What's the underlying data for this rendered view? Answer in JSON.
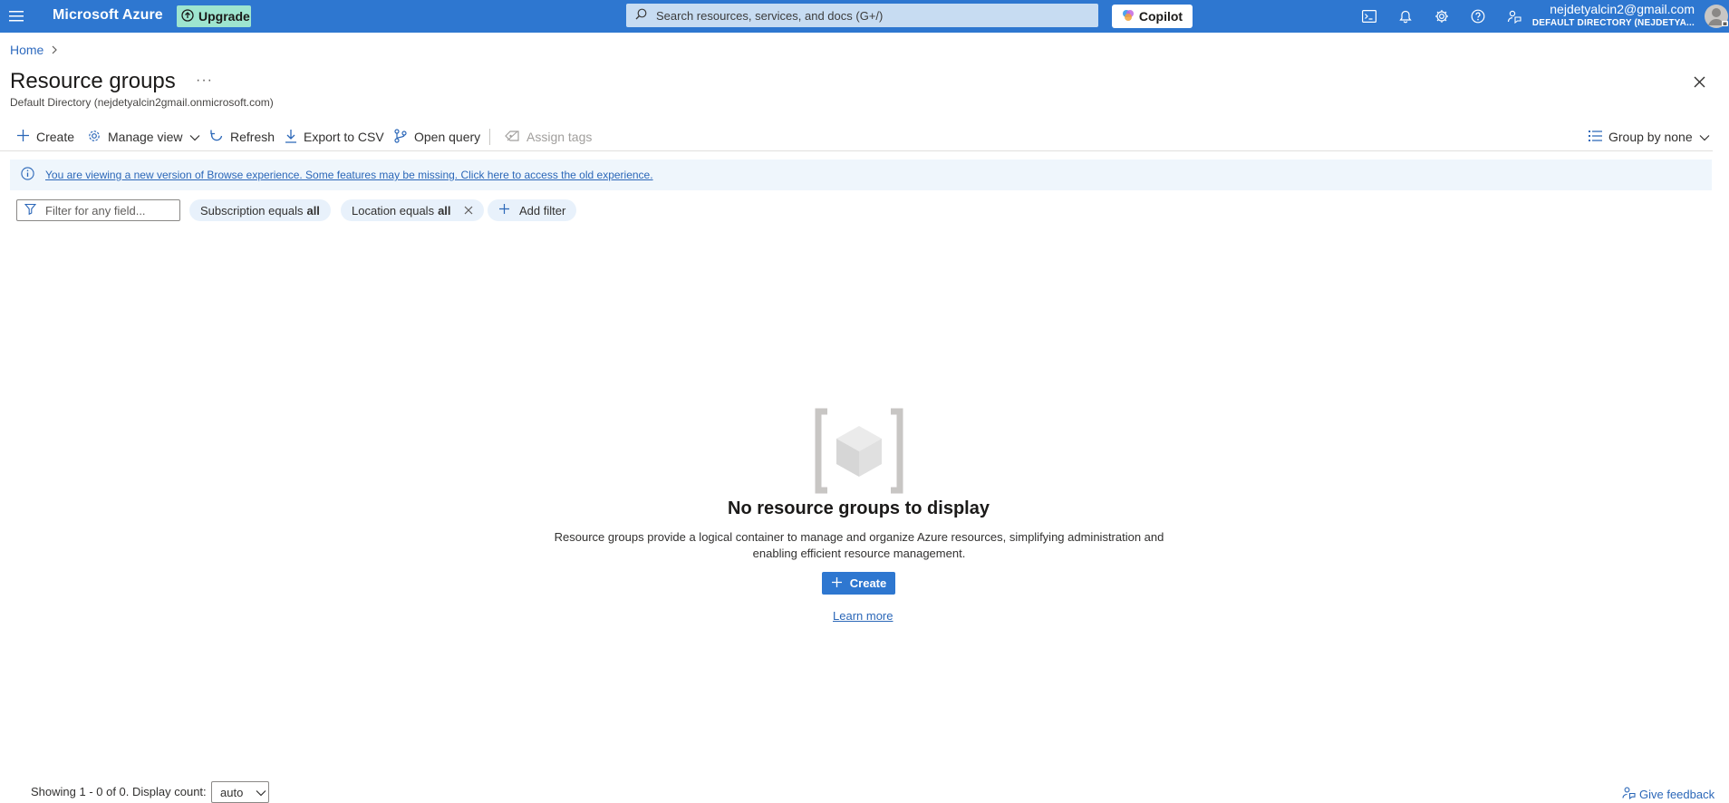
{
  "topbar": {
    "brand": "Microsoft Azure",
    "upgrade_label": "Upgrade",
    "search_placeholder": "Search resources, services, and docs (G+/)",
    "copilot_label": "Copilot",
    "account_email": "nejdetyalcin2@gmail.com",
    "account_directory": "DEFAULT DIRECTORY (NEJDETYA..."
  },
  "breadcrumb": {
    "home": "Home"
  },
  "page": {
    "title": "Resource groups",
    "more": "···",
    "subtitle": "Default Directory (nejdetyalcin2gmail.onmicrosoft.com)"
  },
  "toolbar": {
    "create": "Create",
    "manage_view": "Manage view",
    "refresh": "Refresh",
    "export_csv": "Export to CSV",
    "open_query": "Open query",
    "assign_tags": "Assign tags",
    "group_by": "Group by none"
  },
  "banner": {
    "text": "You are viewing a new version of Browse experience. Some features may be missing. Click here to access the old experience."
  },
  "filters": {
    "placeholder": "Filter for any field...",
    "subscription_label": "Subscription equals",
    "subscription_value": "all",
    "location_label": "Location equals",
    "location_value": "all",
    "add_filter": "Add filter"
  },
  "empty_state": {
    "title": "No resource groups to display",
    "description": "Resource groups provide a logical container to manage and organize Azure resources, simplifying administration and enabling efficient resource management.",
    "create": "Create",
    "learn_more": "Learn more"
  },
  "footer": {
    "showing": "Showing 1 - 0 of 0. Display count:",
    "display_count": "auto",
    "feedback": "Give feedback"
  },
  "colors": {
    "topbar": "#2e77d0",
    "link": "#2b67b8",
    "upgrade_bg": "#9ee5cf",
    "banner_bg": "#eff6fc",
    "pill_bg": "#e8f1fb"
  }
}
